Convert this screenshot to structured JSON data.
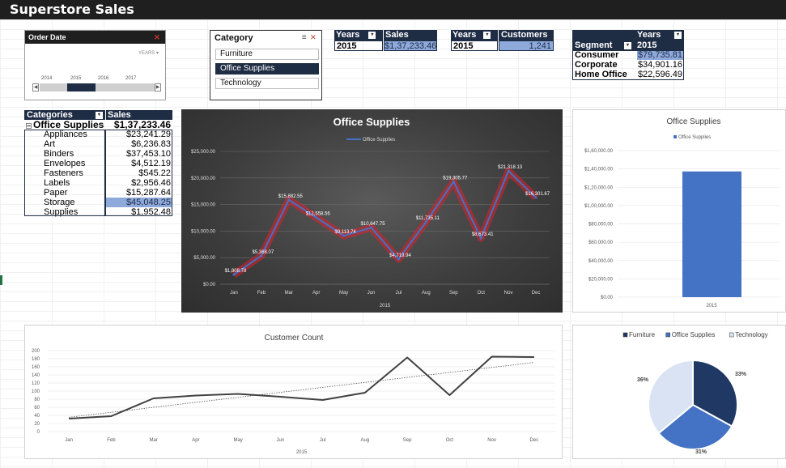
{
  "title": "Superstore Sales",
  "timeline": {
    "label": "Order Date",
    "level": "YEARS",
    "years": [
      "2014",
      "2015",
      "2016",
      "2017"
    ],
    "selected": "2015"
  },
  "category_slicer": {
    "label": "Category",
    "items": [
      "Furniture",
      "Office Supplies",
      "Technology"
    ],
    "selected": "Office Supplies"
  },
  "pivot_sales": {
    "col1": "Years",
    "col2": "Sales",
    "year": "2015",
    "value": "$1,37,233.46"
  },
  "pivot_customers": {
    "col1": "Years",
    "col2": "Customers",
    "year": "2015",
    "value": "1,241"
  },
  "pivot_segment": {
    "years_label": "Years",
    "segment_label": "Segment",
    "year": "2015",
    "rows": [
      {
        "name": "Consumer",
        "value": "$79,735.81"
      },
      {
        "name": "Corporate",
        "value": "$34,901.16"
      },
      {
        "name": "Home Office",
        "value": "$22,596.49"
      }
    ]
  },
  "pivot_categories": {
    "col1": "Categories",
    "col2": "Sales",
    "group": "Office Supplies",
    "group_value": "$1,37,233.46",
    "rows": [
      {
        "name": "Appliances",
        "value": "$23,241.29"
      },
      {
        "name": "Art",
        "value": "$6,236.83"
      },
      {
        "name": "Binders",
        "value": "$37,453.10"
      },
      {
        "name": "Envelopes",
        "value": "$4,512.19"
      },
      {
        "name": "Fasteners",
        "value": "$545.22"
      },
      {
        "name": "Labels",
        "value": "$2,956.46"
      },
      {
        "name": "Paper",
        "value": "$15,287.64"
      },
      {
        "name": "Storage",
        "value": "$45,048.25"
      },
      {
        "name": "Supplies",
        "value": "$1,952.48"
      }
    ],
    "highlight_row": "Storage"
  },
  "chart_data": [
    {
      "type": "line",
      "title": "Office Supplies",
      "xlabel": "2015",
      "ylabel": "",
      "categories": [
        "Jan",
        "Feb",
        "Mar",
        "Apr",
        "May",
        "Jun",
        "Jul",
        "Aug",
        "Sep",
        "Oct",
        "Nov",
        "Dec"
      ],
      "series": [
        {
          "name": "Office Supplies",
          "values": [
            1808.78,
            5368.07,
            15882.55,
            12558.56,
            9113.74,
            10647.75,
            4719.94,
            11735.11,
            19305.77,
            8673.41,
            21318.13,
            16301.67
          ]
        }
      ],
      "data_labels": [
        "$1,808.78",
        "$5,368.07",
        "$15,882.55",
        "$12,558.56",
        "$9,113.74",
        "$10,647.75",
        "$4,719.94",
        "$11,735.11",
        "$19,305.77",
        "$8,673.41",
        "$21,318.13",
        "$16,301.67"
      ],
      "y_ticks": [
        "$0.00",
        "$5,000.00",
        "$10,000.00",
        "$15,000.00",
        "$20,000.00",
        "$25,000.00"
      ],
      "ylim": [
        0,
        25000
      ],
      "legend": "top",
      "colors": {
        "line": "#4472c4",
        "glow": "#e0202a"
      }
    },
    {
      "type": "bar",
      "title": "Office Supplies",
      "categories": [
        "2015"
      ],
      "series": [
        {
          "name": "Office Supplies",
          "values": [
            137233.46
          ]
        }
      ],
      "y_ticks": [
        "$0.00",
        "$20,000.00",
        "$40,000.00",
        "$60,000.00",
        "$80,000.00",
        "$1,00,000.00",
        "$1,20,000.00",
        "$1,40,000.00",
        "$1,60,000.00"
      ],
      "ylim": [
        0,
        160000
      ],
      "legend": "top",
      "colors": {
        "bar": "#4472c4"
      }
    },
    {
      "type": "line",
      "title": "Customer Count",
      "xlabel": "2015",
      "categories": [
        "Jan",
        "Feb",
        "Mar",
        "Apr",
        "May",
        "Jun",
        "Jul",
        "Aug",
        "Sep",
        "Oct",
        "Nov",
        "Dec"
      ],
      "series": [
        {
          "name": "Customer Count",
          "values": [
            32,
            38,
            82,
            89,
            93,
            86,
            78,
            96,
            183,
            90,
            185,
            184
          ]
        }
      ],
      "trendline": true,
      "y_ticks": [
        "0",
        "20",
        "40",
        "60",
        "80",
        "100",
        "120",
        "140",
        "160",
        "180",
        "200"
      ],
      "ylim": [
        0,
        200
      ],
      "colors": {
        "line": "#404040",
        "trend": "#555555"
      }
    },
    {
      "type": "pie",
      "categories": [
        "Furniture",
        "Office Supplies",
        "Technology"
      ],
      "values": [
        33,
        31,
        36
      ],
      "labels": [
        "33%",
        "31%",
        "36%"
      ],
      "legend": "top",
      "colors": {
        "Furniture": "#203864",
        "Office Supplies": "#4472c4",
        "Technology": "#dae3f3"
      }
    }
  ]
}
